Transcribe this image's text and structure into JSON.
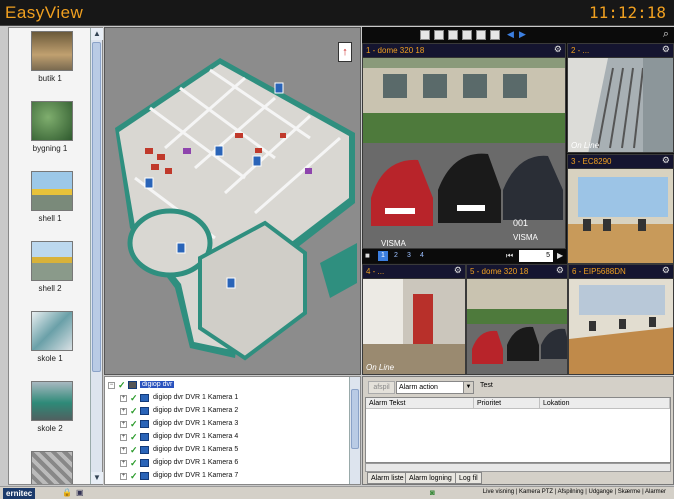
{
  "app": {
    "title": "EasyView",
    "clock": "11:12:18"
  },
  "thumbnails": [
    {
      "label": "butik 1",
      "icon": "building-thumb"
    },
    {
      "label": "bygning 1",
      "icon": "map-thumb"
    },
    {
      "label": "shell 1",
      "icon": "gas-station-thumb"
    },
    {
      "label": "shell 2",
      "icon": "gas-station-thumb"
    },
    {
      "label": "skole 1",
      "icon": "building-thumb"
    },
    {
      "label": "skole 2",
      "icon": "building-thumb"
    },
    {
      "label": "",
      "icon": "floorplan-thumb"
    }
  ],
  "tree": {
    "root": "digiop dvr",
    "items": [
      "digiop dvr DVR 1 Kamera 1",
      "digiop dvr DVR 1 Kamera 2",
      "digiop dvr DVR 1 Kamera 3",
      "digiop dvr DVR 1 Kamera 4",
      "digiop dvr DVR 1 Kamera 5",
      "digiop dvr DVR 1 Kamera 6",
      "digiop dvr DVR 1 Kamera 7"
    ]
  },
  "cameras": {
    "tile1": {
      "name": "1 - dome 320 18",
      "status": ""
    },
    "tile2": {
      "name": "2 - ...",
      "status": "On Line"
    },
    "tile3": {
      "name": "3 - EC8290",
      "status": ""
    },
    "tile4": {
      "name": "4 - ...",
      "status": "On Line"
    },
    "tile5": {
      "name": "5 - dome 320 18",
      "status": ""
    },
    "tile6": {
      "name": "6 - EIP5688DN",
      "status": ""
    }
  },
  "scene_text": {
    "plate1": "VISMA",
    "plate2": "VISMA",
    "plate3": "001"
  },
  "pager": {
    "pages": [
      "1",
      "2",
      "3",
      "4"
    ],
    "rate": "5"
  },
  "alarm": {
    "button_label": "afspil",
    "selected_action": "Alarm action",
    "test_label": "Test",
    "columns": [
      "Alarm Tekst",
      "Prioritet",
      "Lokation"
    ],
    "tabs": [
      "Alarm liste",
      "Alarm logning",
      "Log fil"
    ]
  },
  "status": {
    "logo": "ernitec",
    "menu": "Live visning | Kamera PTZ | Afspilning | Udgange | Skærme | Alarmer"
  },
  "colors": {
    "accent": "#f0a020",
    "select": "#2a52be"
  }
}
